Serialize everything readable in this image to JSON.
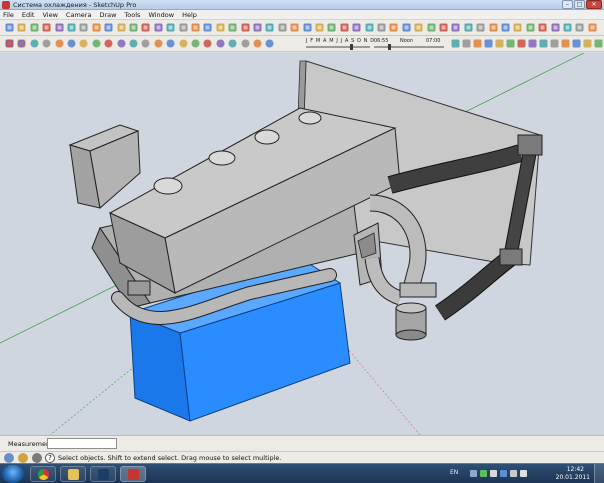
{
  "window": {
    "title": "Система охлаждения - SketchUp Pro",
    "minimize_glyph": "–",
    "maximize_glyph": "□",
    "close_glyph": "✕"
  },
  "menu": {
    "items": [
      "File",
      "Edit",
      "View",
      "Camera",
      "Draw",
      "Tools",
      "Window",
      "Help"
    ]
  },
  "toolbar": {
    "shadow_months": "J F M A M J J A S O N D",
    "time_start": "06:55",
    "noon_label": "Noon",
    "time_end": "07:00"
  },
  "measurements": {
    "label": "Measurements",
    "value": ""
  },
  "status": {
    "hint": "Select objects. Shift to extend select. Drag mouse to select multiple."
  },
  "taskbar": {
    "lang": "EN",
    "time": "12:42",
    "date": "20.01.2011"
  },
  "colors": {
    "accent_blue": "#1e7ff0",
    "model_gray": "#b5b5b5",
    "hose_dark": "#3a3a3a",
    "sky": "#cfd6e0"
  },
  "icons": [
    "select-icon",
    "make-component-icon",
    "eraser-icon",
    "paint-bucket-icon",
    "rectangle-icon",
    "circle-icon",
    "arc-icon",
    "freehand-icon",
    "push-pull-icon",
    "move-icon",
    "rotate-icon",
    "scale-icon",
    "follow-me-icon",
    "offset-icon",
    "tape-measure-icon",
    "dimension-icon",
    "protractor-icon",
    "text-icon",
    "axes-icon",
    "3d-text-icon",
    "orbit-icon",
    "pan-icon",
    "zoom-icon",
    "zoom-window-icon",
    "zoom-extents-icon",
    "previous-view-icon",
    "next-view-icon",
    "position-camera-icon",
    "walk-icon",
    "look-around-icon",
    "section-plane-icon",
    "xray-icon",
    "wireframe-icon",
    "hidden-line-icon",
    "shaded-icon",
    "shaded-texture-icon",
    "monochrome-icon",
    "iso-view-icon",
    "top-view-icon",
    "front-view-icon",
    "right-view-icon",
    "back-view-icon",
    "left-view-icon",
    "google-earth-icon",
    "warehouse-icon",
    "share-model-icon",
    "get-models-icon",
    "sandbox-icon",
    "shadows-icon",
    "fog-icon"
  ]
}
